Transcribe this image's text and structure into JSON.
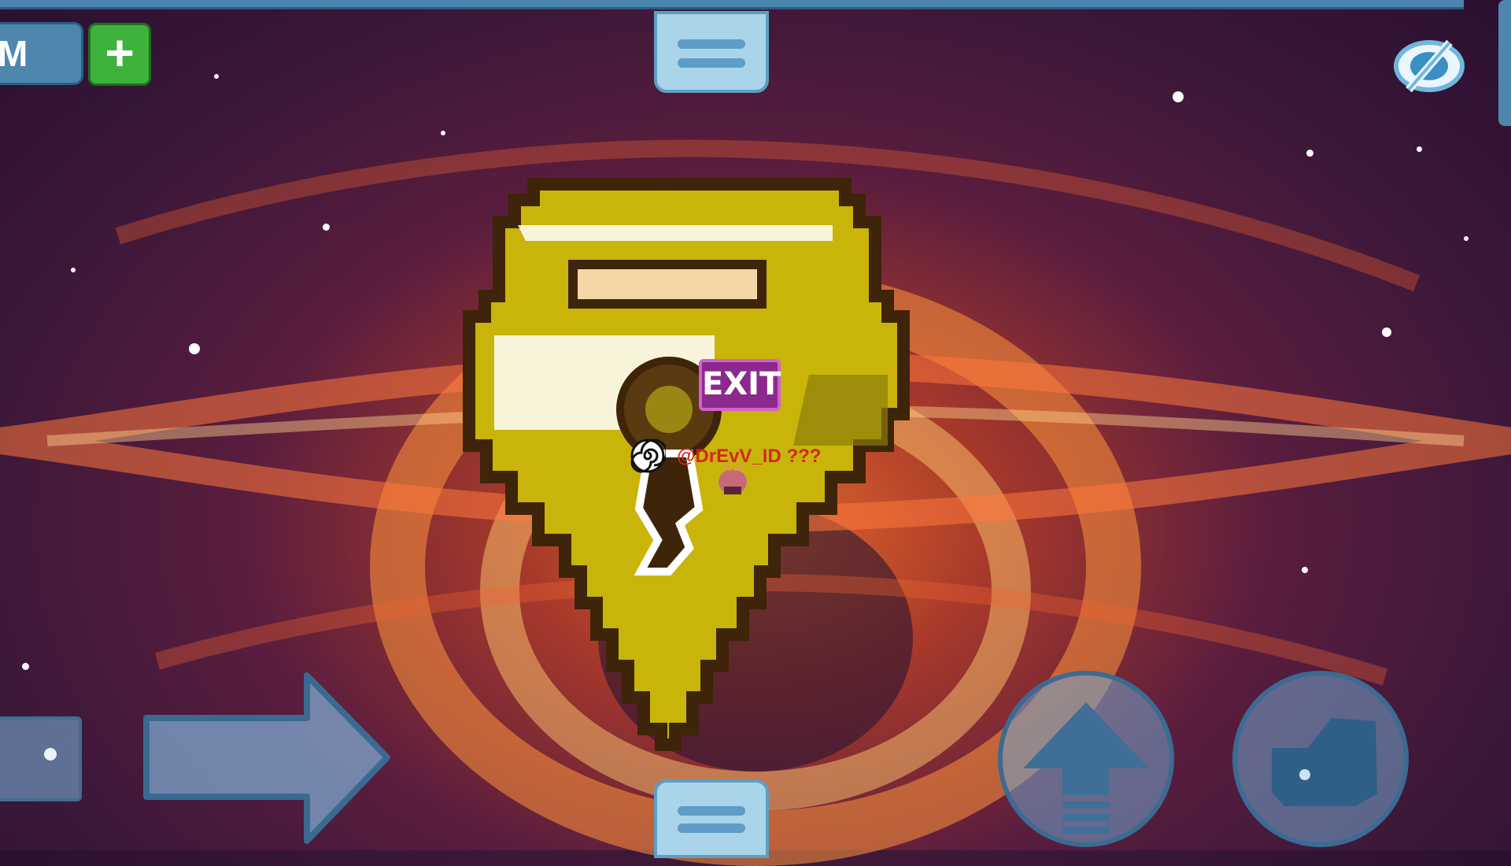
{
  "hud": {
    "gems_label": "M",
    "add_button_label": "+"
  },
  "world": {
    "exit_sign": "EXIT",
    "player_name": "@DrEvV_ID ???"
  },
  "icons": {
    "menu": "hamburger-icon",
    "visibility": "eye-slash-icon",
    "move_right": "arrow-right-icon",
    "jump": "arrow-up-icon",
    "punch": "fist-icon",
    "portal": "spiral-icon"
  },
  "colors": {
    "sky_dark": "#3a1738",
    "sky_glow": "#e06a2a",
    "hud_blue": "#4f86ad",
    "add_green": "#3fb23c",
    "lock_gold": "#c9b40a",
    "lock_outline": "#3e2408",
    "exit_purple": "#8b2a8c",
    "name_red": "#d0281e"
  }
}
